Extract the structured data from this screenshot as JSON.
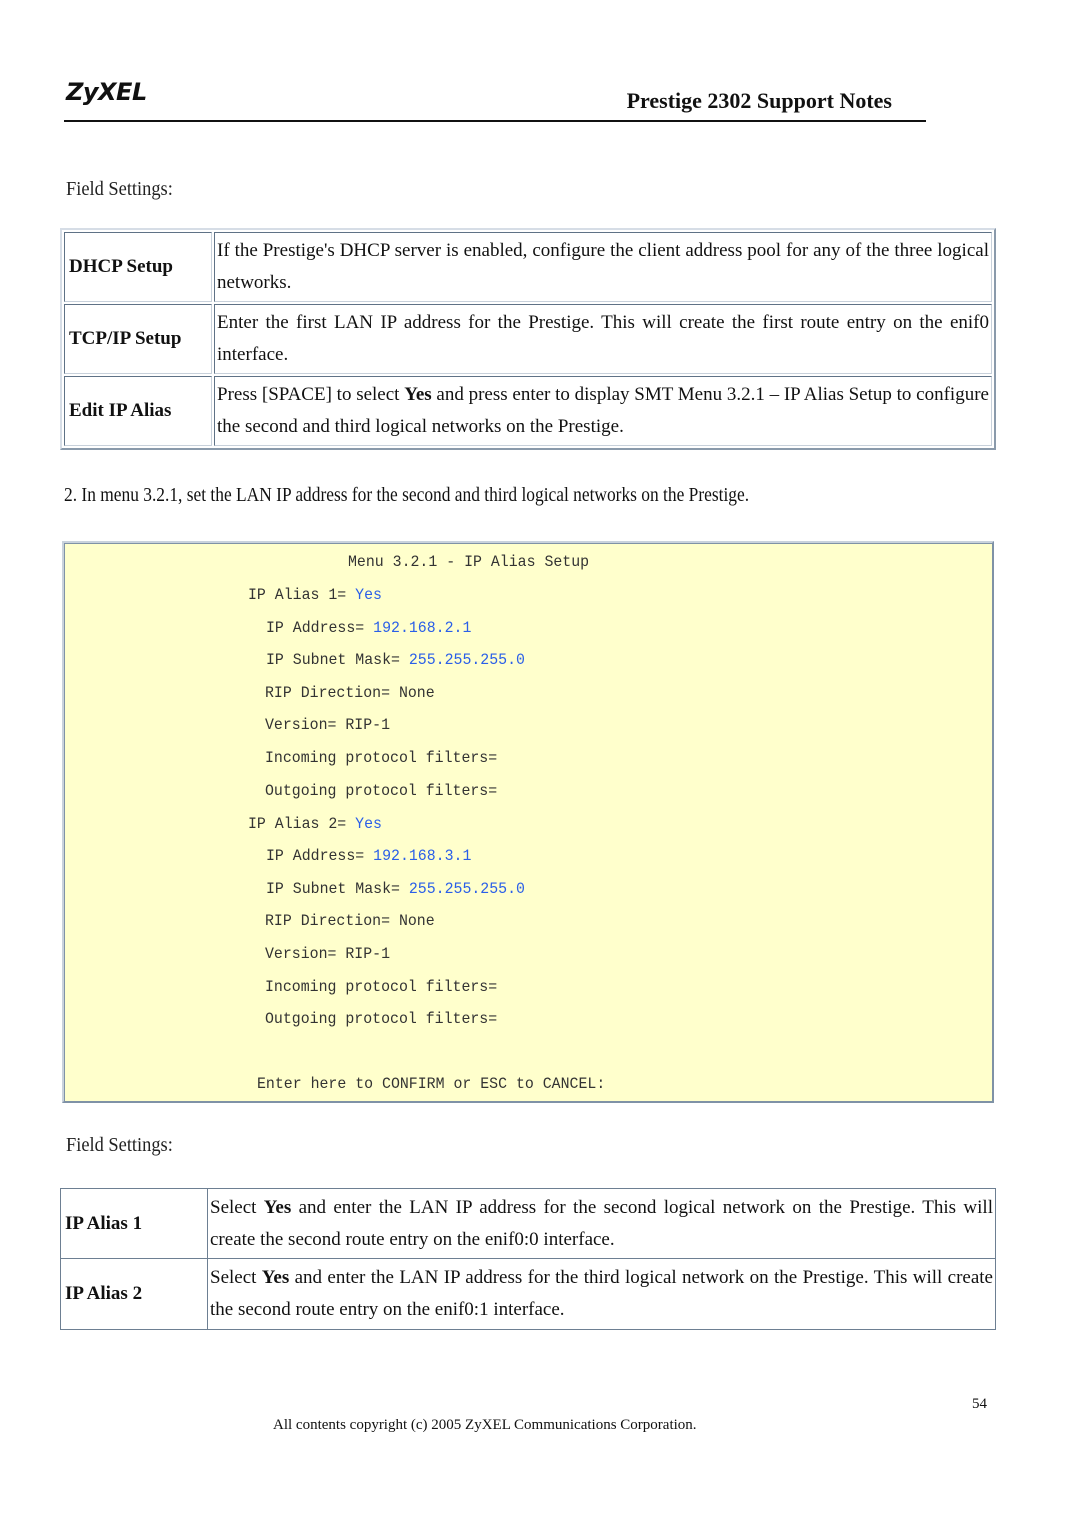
{
  "header": {
    "logo": "ZyXEL",
    "title": "Prestige 2302 Support Notes"
  },
  "section1": {
    "label": "Field Settings:",
    "rows": [
      {
        "key": "DHCP Setup",
        "text": "If the Prestige's DHCP server is enabled, configure the client address pool for any of the three logical networks."
      },
      {
        "key": "TCP/IP Setup",
        "text": "Enter the first LAN IP address for the Prestige. This will create the first route entry on the enif0 interface."
      },
      {
        "key": "Edit IP Alias",
        "text_pre": "Press [SPACE] to select ",
        "text_bold": "Yes",
        "text_post": " and press enter to display SMT Menu 3.2.1 – IP Alias Setup to configure the second and third logical networks on the Prestige."
      }
    ]
  },
  "step2": "2. In menu 3.2.1, set the LAN IP address for the second and third logical networks on the Prestige.",
  "terminal": {
    "title": "Menu 3.2.1 - IP Alias Setup",
    "alias1": {
      "label": "IP Alias 1= ",
      "value": "Yes",
      "ip_label": "IP Address= ",
      "ip": "192.168.2.1",
      "mask_label": "IP Subnet Mask= ",
      "mask": "255.255.255.0",
      "rip": "RIP Direction= None",
      "version": "Version= RIP-1",
      "incoming": "Incoming protocol filters=",
      "outgoing": "Outgoing protocol filters="
    },
    "alias2": {
      "label": "IP Alias 2= ",
      "value": "Yes",
      "ip_label": "IP Address= ",
      "ip": "192.168.3.1",
      "mask_label": "IP Subnet Mask= ",
      "mask": "255.255.255.0",
      "rip": "RIP Direction= None",
      "version": "Version= RIP-1",
      "incoming": "Incoming protocol filters=",
      "outgoing": "Outgoing protocol filters="
    },
    "prompt": "Enter here to CONFIRM or ESC to CANCEL:"
  },
  "section2": {
    "label": "Field Settings:",
    "rows": [
      {
        "key": "IP Alias 1",
        "text_pre": "Select ",
        "text_bold": "Yes",
        "text_post": " and enter the LAN IP address for the second logical network on the Prestige. This will create the second route entry on the enif0:0 interface."
      },
      {
        "key": "IP Alias 2",
        "text_pre": "Select ",
        "text_bold": "Yes",
        "text_post": " and enter the LAN IP address for the third logical network on the Prestige. This will create the second route entry on the enif0:1 interface."
      }
    ]
  },
  "footer": {
    "page_number": "54",
    "copyright": "All contents copyright (c) 2005 ZyXEL Communications Corporation."
  }
}
